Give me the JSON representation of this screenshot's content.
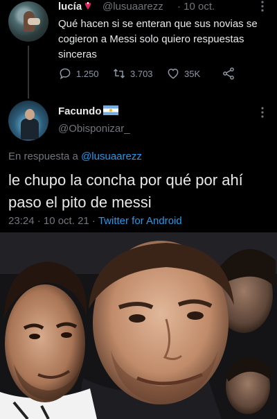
{
  "tweet": {
    "author_name": "lucía",
    "author_handle": "@lusuaarezz",
    "date": "· 10 oct.",
    "text": "Qué hacen si se enteran que sus novias se cogieron a Messi solo quiero respuestas sinceras",
    "replies": "1.250",
    "retweets": "3.703",
    "likes": "35K"
  },
  "reply": {
    "author_name": "Facundo",
    "author_handle": "@Obisponizar_",
    "in_reply_prefix": "En respuesta a",
    "in_reply_handle": "@lusuaarezz",
    "text": "le chupo la concha por qué por ahí paso el pito de messi",
    "timestamp": "23:24 · 10 oct. 21 ·",
    "source": "Twitter for Android"
  },
  "colors": {
    "background": "#000000",
    "text": "#e7e9ea",
    "muted": "#71767b",
    "link": "#1d9bf0"
  },
  "icons": {
    "reply": "reply-icon",
    "retweet": "retweet-icon",
    "like": "heart-icon",
    "share": "share-icon",
    "more": "more-icon"
  }
}
